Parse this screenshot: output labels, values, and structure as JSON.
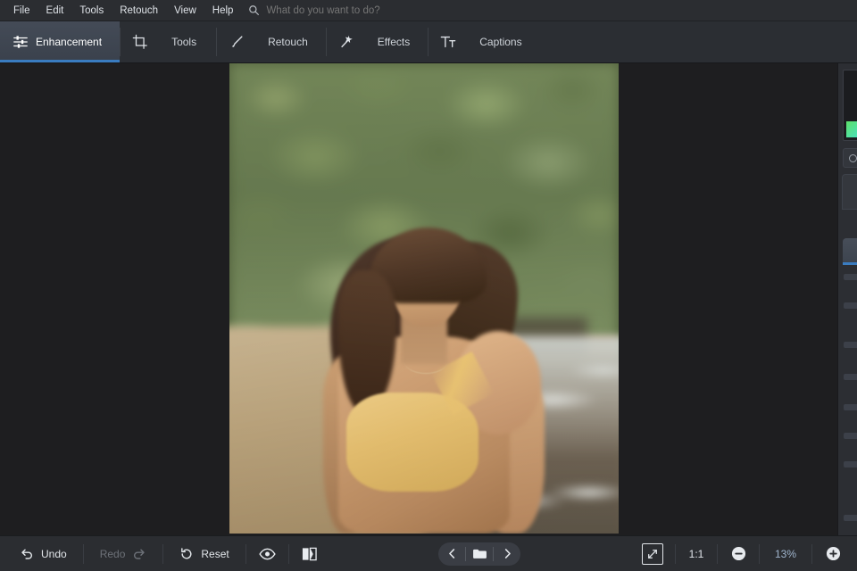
{
  "app": {
    "accent_color": "#3a7cc0",
    "bg_color": "#1e1e20",
    "chrome_color": "#2b2d31"
  },
  "menubar": {
    "items": [
      {
        "label": "File"
      },
      {
        "label": "Edit"
      },
      {
        "label": "Tools"
      },
      {
        "label": "Retouch"
      },
      {
        "label": "View"
      },
      {
        "label": "Help"
      }
    ],
    "search": {
      "icon": "search-icon",
      "placeholder": "What do you want to do?",
      "value": ""
    }
  },
  "tabbar": {
    "active_index": 0,
    "tabs": [
      {
        "label": "Enhancement",
        "icon": "sliders-icon",
        "active": true
      },
      {
        "label": "Tools",
        "icon": "crop-icon",
        "active": false
      },
      {
        "label": "Retouch",
        "icon": "brush-icon",
        "active": false
      },
      {
        "label": "Effects",
        "icon": "magic-wand-icon",
        "active": false
      },
      {
        "label": "Captions",
        "icon": "text-tool-icon",
        "active": false
      }
    ]
  },
  "canvas": {
    "photo": {
      "alt": "Woman in yellow one-shoulder top standing on a tropical beach with blurred green foliage behind her",
      "zoom_percent": "13%"
    }
  },
  "bottombar": {
    "undo": {
      "label": "Undo",
      "icon": "undo-arrow-icon",
      "enabled": true
    },
    "redo": {
      "label": "Redo",
      "icon": "redo-arrow-icon",
      "enabled": false
    },
    "reset": {
      "label": "Reset",
      "icon": "reset-circle-icon",
      "enabled": true
    },
    "preview": {
      "icon": "eye-icon",
      "label": ""
    },
    "compare": {
      "icon": "split-compare-icon",
      "label": ""
    },
    "nav": {
      "prev": {
        "icon": "chevron-left-icon"
      },
      "browse": {
        "icon": "folder-icon"
      },
      "next": {
        "icon": "chevron-right-icon"
      }
    },
    "zoom": {
      "fit": {
        "icon": "fit-to-screen-icon"
      },
      "actual": {
        "label": "1:1"
      },
      "out": {
        "icon": "zoom-out-icon"
      },
      "value": "13%",
      "in": {
        "icon": "zoom-in-icon"
      }
    }
  }
}
